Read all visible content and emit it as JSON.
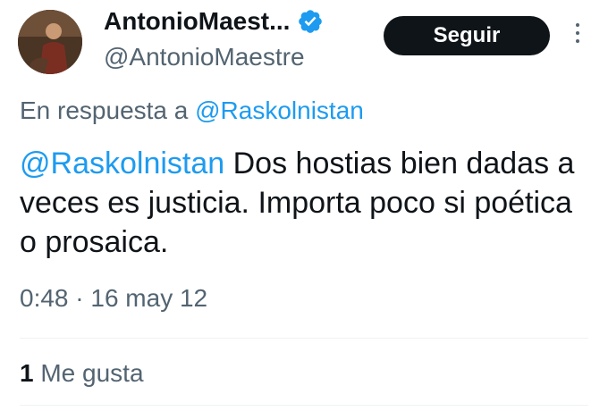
{
  "author": {
    "display_name": "AntonioMaest...",
    "handle": "@AntonioMaestre",
    "verified": true
  },
  "follow_label": "Seguir",
  "reply_context": {
    "prefix": "En respuesta a",
    "mention": "@Raskolnistan"
  },
  "tweet": {
    "mention": "@Raskolnistan",
    "text": "Dos hostias bien dadas a veces es justicia. Importa poco si poética o prosaica."
  },
  "timestamp": "0:48 · 16 may 12",
  "likes": {
    "count": "1",
    "label": "Me gusta"
  },
  "colors": {
    "link": "#1d9bf0",
    "secondary_text": "#536471",
    "primary_text": "#0f1419",
    "follow_button_bg": "#0f1419"
  },
  "icons": {
    "verified": "verified-badge-icon",
    "more": "more-vertical-icon"
  }
}
